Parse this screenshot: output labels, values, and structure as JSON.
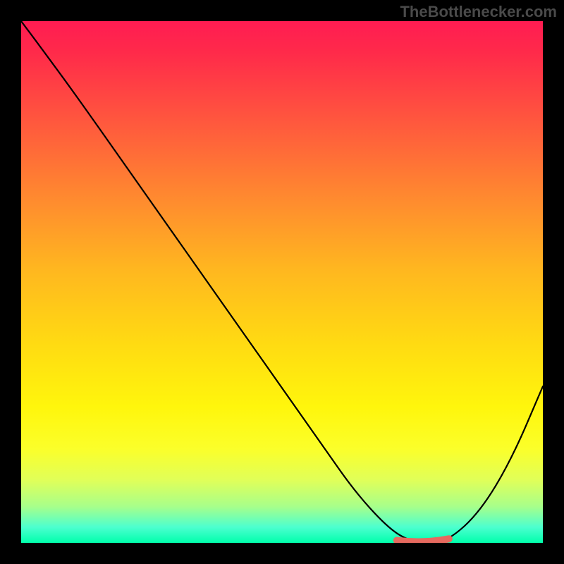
{
  "watermark": "TheBottlenecker.com",
  "chart_data": {
    "type": "line",
    "title": "",
    "xlabel": "",
    "ylabel": "",
    "xlim": [
      0,
      100
    ],
    "ylim": [
      0,
      100
    ],
    "series": [
      {
        "name": "curve",
        "x": [
          0,
          3,
          10,
          20,
          30,
          40,
          50,
          58,
          64,
          70,
          74,
          78,
          82,
          88,
          94,
          100
        ],
        "y": [
          100,
          96,
          86.5,
          72.3,
          58.1,
          43.9,
          29.7,
          18.3,
          9.8,
          3.2,
          0.5,
          0.0,
          0.5,
          6.0,
          16.0,
          30.0
        ],
        "notes": "Black V-shaped curve; minimum region (nadir) between x≈72 and x≈82."
      },
      {
        "name": "optimal-highlight",
        "x": [
          72,
          82
        ],
        "y": [
          0.2,
          0.5
        ],
        "color": "#e76a5f",
        "notes": "Thick salmon/red segment marking the optimal (bottleneck-free) zone near the minimum of the curve."
      }
    ],
    "background_gradient": {
      "top": "#ff1c52",
      "mid": "#ffdb12",
      "bottom": "#00ffac"
    }
  }
}
